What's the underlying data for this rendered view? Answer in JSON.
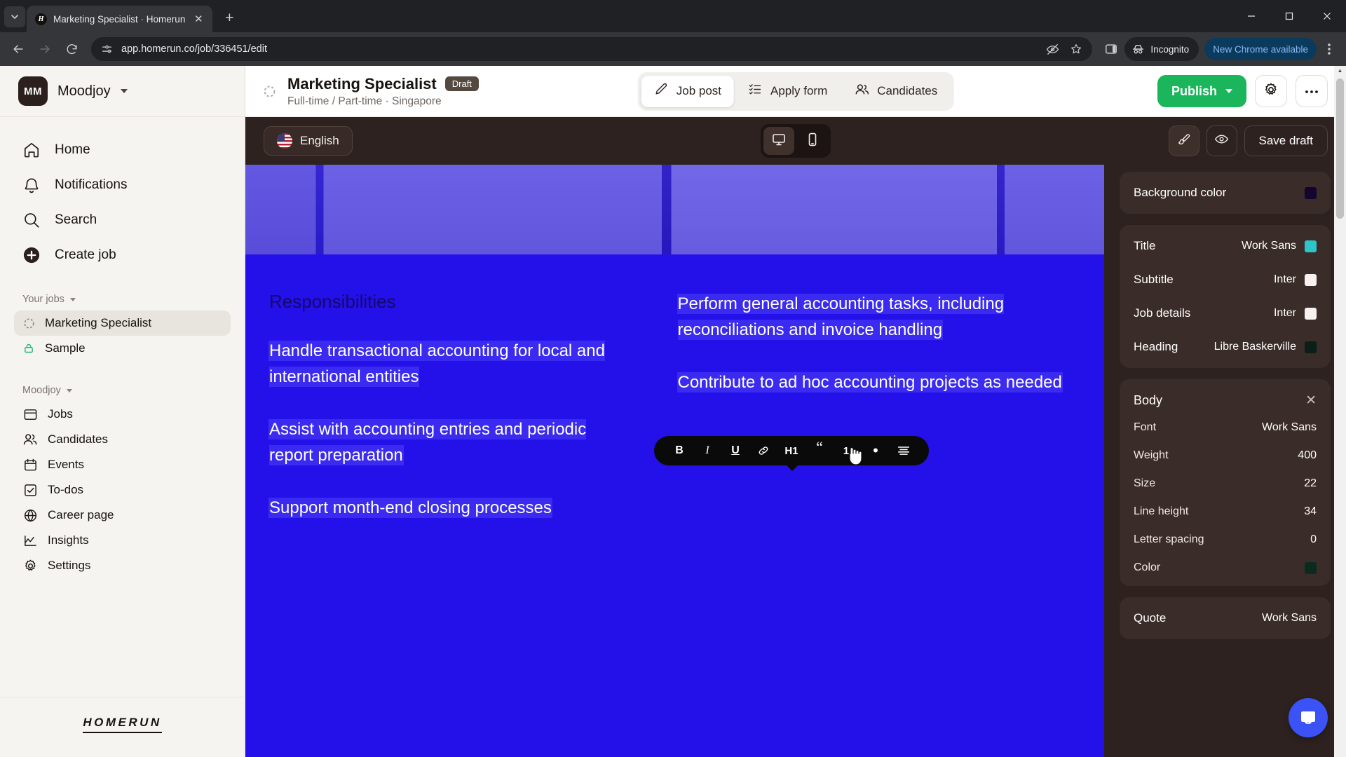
{
  "browser": {
    "tab": {
      "title": "Marketing Specialist · Homerun",
      "favicon_letter": "H"
    },
    "tab_search_icon": "chevron-down-icon",
    "new_tab_label": "+",
    "close_tab_label": "✕",
    "window": {
      "minimize": "—",
      "maximize": "▢",
      "close": "✕"
    },
    "nav": {
      "back": "←",
      "forward": "→",
      "reload": "⟳"
    },
    "url": "app.homerun.co/job/336451/edit",
    "site_info_icon": "page-settings-icon",
    "omni_actions": [
      "hidden-eye-icon",
      "bookmark-star-icon"
    ],
    "side_panel_icon": "side-panel-icon",
    "incognito_label": "Incognito",
    "chrome_update_label": "New Chrome available",
    "menu_icon": "kebab-menu-icon"
  },
  "sidebar": {
    "org": {
      "initials": "MM",
      "name": "Moodjoy"
    },
    "nav": [
      {
        "label": "Home",
        "icon": "home-icon"
      },
      {
        "label": "Notifications",
        "icon": "bell-icon"
      },
      {
        "label": "Search",
        "icon": "search-icon"
      },
      {
        "label": "Create job",
        "icon": "plus-circle-icon"
      }
    ],
    "your_jobs": {
      "label": "Your jobs",
      "items": [
        {
          "label": "Marketing Specialist",
          "icon": "dotted-circle-icon",
          "active": true
        },
        {
          "label": "Sample",
          "icon": "green-lock-icon",
          "active": false
        }
      ]
    },
    "workspace": {
      "label": "Moodjoy",
      "items": [
        {
          "label": "Jobs",
          "icon": "board-icon"
        },
        {
          "label": "Candidates",
          "icon": "people-icon"
        },
        {
          "label": "Events",
          "icon": "calendar-icon"
        },
        {
          "label": "To-dos",
          "icon": "checkbox-icon"
        },
        {
          "label": "Career page",
          "icon": "globe-icon"
        },
        {
          "label": "Insights",
          "icon": "chart-line-icon"
        },
        {
          "label": "Settings",
          "icon": "gear-icon"
        }
      ]
    },
    "footer_logo": "HOMERUN"
  },
  "app_header": {
    "job_title": "Marketing Specialist",
    "status_badge": "Draft",
    "job_subtitle": "Full-time / Part-time · Singapore",
    "tabs": [
      {
        "label": "Job post",
        "icon": "pencil-icon",
        "active": true
      },
      {
        "label": "Apply form",
        "icon": "checklist-icon",
        "active": false
      },
      {
        "label": "Candidates",
        "icon": "people-icon",
        "active": false
      }
    ],
    "publish_label": "Publish",
    "settings_icon": "gear-icon",
    "more_icon": "ellipsis-icon"
  },
  "editor_bar": {
    "language": "English",
    "language_flag": "us-flag-icon",
    "devices": [
      {
        "name": "desktop-view",
        "icon": "monitor-icon",
        "active": true
      },
      {
        "name": "mobile-view",
        "icon": "phone-icon",
        "active": false
      }
    ],
    "style_icon": "paintbrush-icon",
    "preview_icon": "eye-icon",
    "save_draft_label": "Save draft"
  },
  "format_toolbar": {
    "buttons": [
      {
        "label": "B",
        "name": "bold-button"
      },
      {
        "label": "I",
        "name": "italic-button"
      },
      {
        "label": "U",
        "name": "underline-button"
      },
      {
        "label": "link",
        "name": "link-icon"
      },
      {
        "label": "H1",
        "name": "heading-1-button"
      },
      {
        "label": "“",
        "name": "quote-button"
      },
      {
        "label": "1.",
        "name": "ordered-list-button"
      },
      {
        "label": "•",
        "name": "bullet-list-button"
      },
      {
        "label": "align",
        "name": "align-icon"
      }
    ]
  },
  "document": {
    "heading": "Responsibilities",
    "left_column": [
      "Handle transactional accounting for local and international entities",
      "Assist with accounting entries and periodic report preparation",
      "Support month-end closing processes"
    ],
    "right_column": [
      "Perform general accounting tasks, including reconciliations and invoice handling",
      "Contribute to ad hoc accounting projects as needed"
    ],
    "background_color": "#2410E8"
  },
  "properties": {
    "background": {
      "label": "Background color",
      "swatch": "#13052e"
    },
    "typography": [
      {
        "label": "Title",
        "value": "Work Sans",
        "swatch": "#2ec5c9"
      },
      {
        "label": "Subtitle",
        "value": "Inter",
        "swatch": "#f7f1ef"
      },
      {
        "label": "Job details",
        "value": "Inter",
        "swatch": "#f7f1ef"
      },
      {
        "label": "Heading",
        "value": "Libre Baskerville",
        "swatch": "#0a1f18"
      }
    ],
    "body": {
      "title": "Body",
      "close": "✕",
      "rows": [
        {
          "key": "Font",
          "value": "Work Sans"
        },
        {
          "key": "Weight",
          "value": "400"
        },
        {
          "key": "Size",
          "value": "22"
        },
        {
          "key": "Line height",
          "value": "34"
        },
        {
          "key": "Letter spacing",
          "value": "0"
        }
      ],
      "color": {
        "key": "Color",
        "swatch": "#0c2a1f"
      }
    },
    "quote": {
      "label": "Quote",
      "value": "Work Sans"
    }
  },
  "intercom": {
    "icon": "chat-bubble-icon"
  }
}
